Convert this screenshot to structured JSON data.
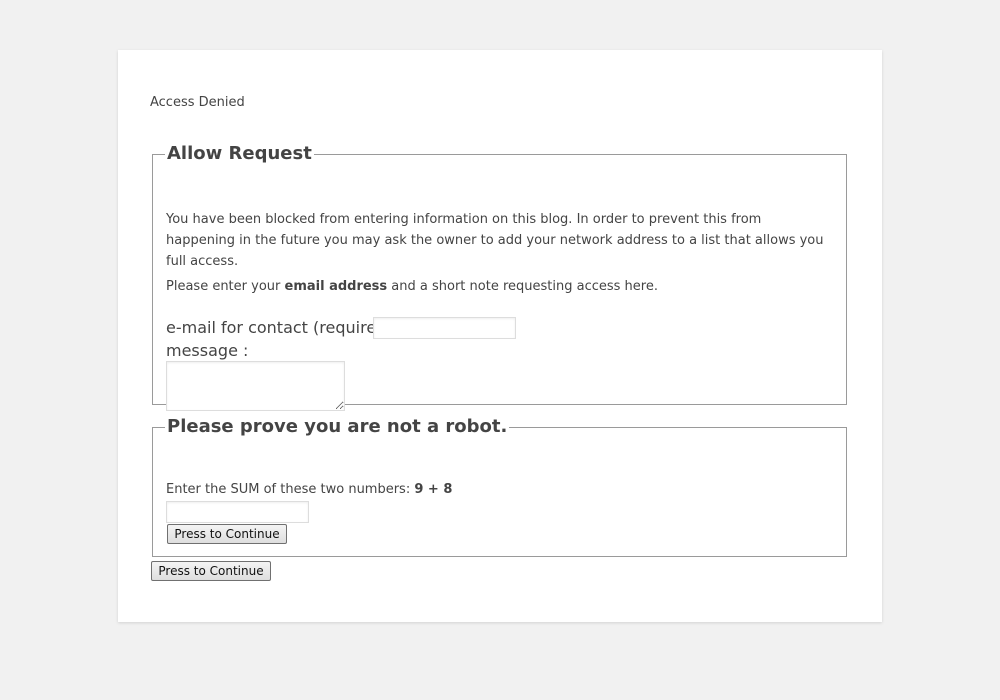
{
  "page": {
    "heading": "Access Denied"
  },
  "allow_request": {
    "legend": "Allow Request",
    "intro": "You have been blocked from entering information on this blog. In order to prevent this from happening in the future you may ask the owner to add your network address to a list that allows you full access.",
    "instruction_prefix": "Please enter your ",
    "instruction_bold": "email address",
    "instruction_suffix": " and a short note requesting access here.",
    "email_label": "e-mail for contact (required):",
    "email_value": "",
    "message_label": "message :",
    "message_value": ""
  },
  "captcha": {
    "legend": "Please prove you are not a robot.",
    "prompt": "Enter the SUM of these two numbers: ",
    "numbers": "9 + 8",
    "answer_value": "",
    "button_label": "Press to Continue"
  },
  "footer": {
    "button_label": "Press to Continue"
  },
  "colors": {
    "background": "#f1f1f1",
    "card": "#ffffff",
    "text": "#444444",
    "fieldset_border": "#9a9a9a"
  }
}
